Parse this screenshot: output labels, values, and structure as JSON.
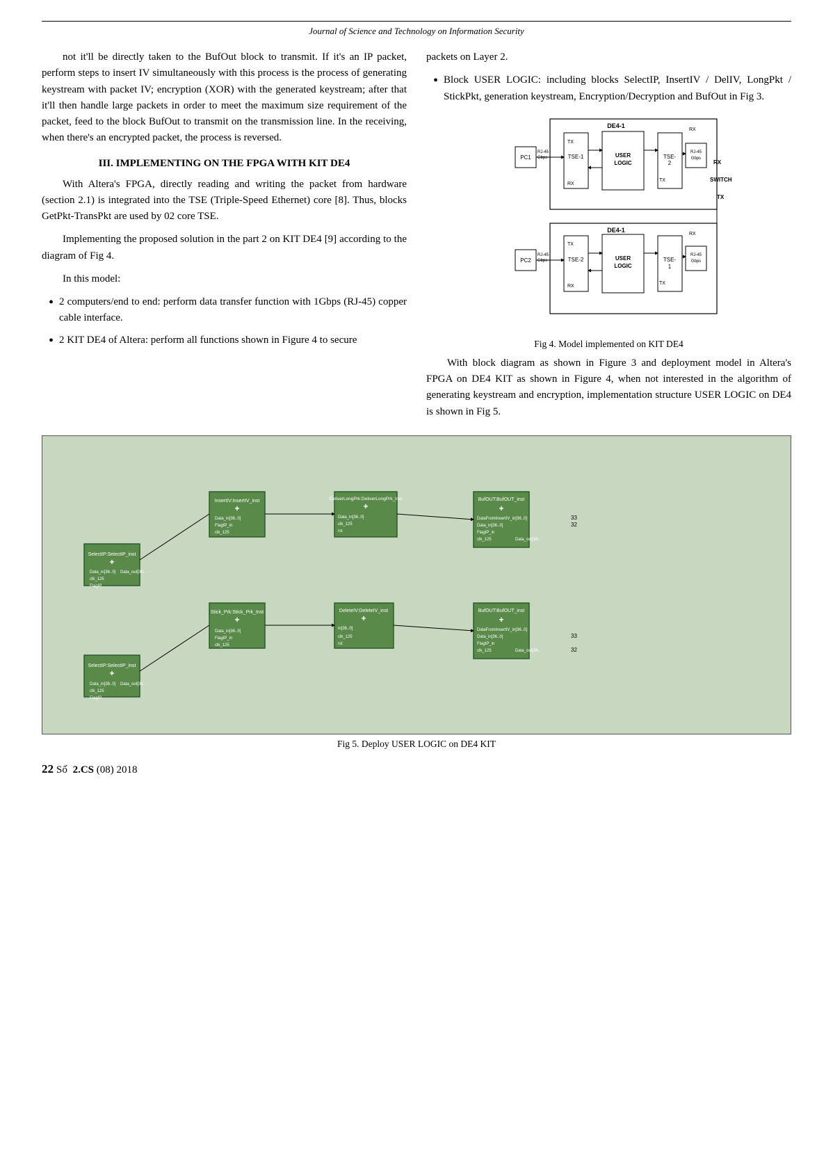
{
  "journal": {
    "title": "Journal of Science and Technology on Information Security"
  },
  "left_col": {
    "para1": "not it'll be directly taken to the BufOut block to transmit. If it's an IP packet, perform steps to insert IV simultaneously with this process is the process of generating keystream with packet IV; encryption (XOR) with the generated keystream; after that it'll then handle large packets in order to meet the maximum size requirement of the packet, feed to the block BufOut to transmit on the transmission line. In the receiving, when there's an encrypted packet, the process is reversed.",
    "section_heading": "III. IMPLEMENTING ON THE FPGA WITH KIT DE4",
    "para2": "With Altera's FPGA, directly reading and writing the packet from hardware (section 2.1) is integrated into the TSE (Triple-Speed Ethernet) core [8]. Thus, blocks GetPkt-TransPkt are used by 02 core TSE.",
    "para3": "Implementing the proposed solution in the part 2 on KIT DE4 [9] according to the diagram of Fig 4.",
    "para4": "In this model:",
    "bullet1": "2 computers/end to end: perform data transfer function with 1Gbps (RJ-45) copper cable interface.",
    "bullet2": "2 KIT DE4 of Altera: perform all functions shown in Figure 4 to secure"
  },
  "right_col": {
    "para1": "packets on Layer 2.",
    "bullet1": "Block USER LOGIC: including blocks SelectIP, InsertIV / DelIV, LongPkt / StickPkt, generation keystream, Encryption/Decryption and BufOut in Fig 3.",
    "fig4_caption": "Fig 4. Model implemented on KIT DE4",
    "para2": "With block diagram as shown in Figure 3 and deployment model in Altera's FPGA on DE4 KIT as shown in Figure 4, when not interested in the algorithm of generating keystream and encryption, implementation structure USER LOGIC on DE4 is shown in Fig 5."
  },
  "fig5": {
    "caption": "Fig 5. Deploy USER LOGIC on DE4 KIT"
  },
  "footer": {
    "number": "22",
    "so_label": "Số",
    "cs_label": "2.CS",
    "year_label": "(08) 2018"
  }
}
